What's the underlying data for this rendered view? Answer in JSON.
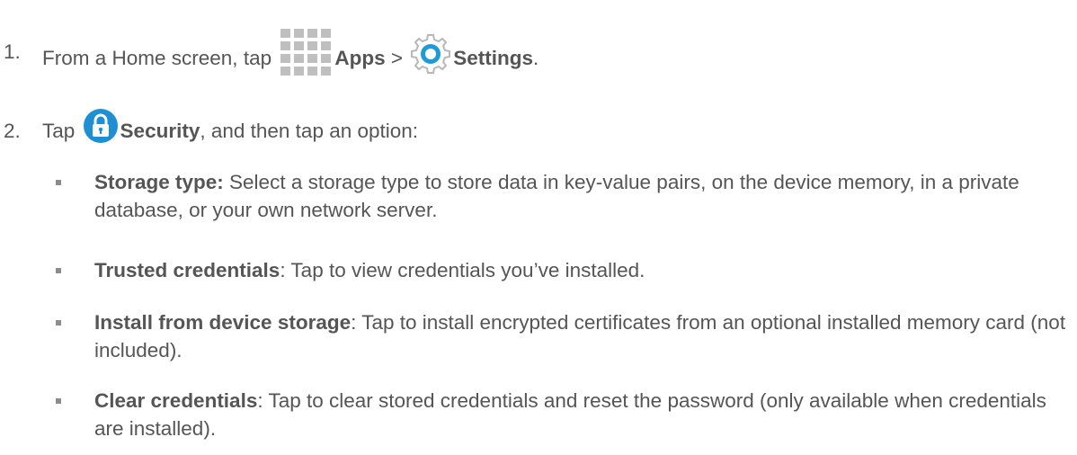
{
  "colors": {
    "text": "#555555",
    "bullet": "#8c8c8c",
    "apps_icon": "#bfbfbf",
    "settings_icon": "#1e9ad6",
    "security_icon": "#1e8fd3"
  },
  "steps": [
    {
      "number": "1.",
      "lead": "From a Home screen, tap",
      "apps_icon": "apps-grid-icon",
      "apps_label": "Apps",
      "separator": ">",
      "settings_icon": "settings-gear-icon",
      "settings_label": "Settings",
      "end": "."
    },
    {
      "number": "2.",
      "lead": "Tap",
      "security_icon": "security-lock-icon",
      "security_label": "Security",
      "rest": ", and then tap an option:"
    }
  ],
  "options": [
    {
      "title": "Storage type:",
      "text": " Select a storage type to store data in key-value pairs, on the device memory, in a private database, or your own network server."
    },
    {
      "title": "Trusted credentials",
      "text": ": Tap to view credentials you’ve installed."
    },
    {
      "title": "Install from device storage",
      "text": ": Tap to install encrypted certificates from an optional installed memory card (not included)."
    },
    {
      "title": "Clear credentials",
      "text": ": Tap to clear stored credentials and reset the password (only available when credentials are installed)."
    }
  ]
}
